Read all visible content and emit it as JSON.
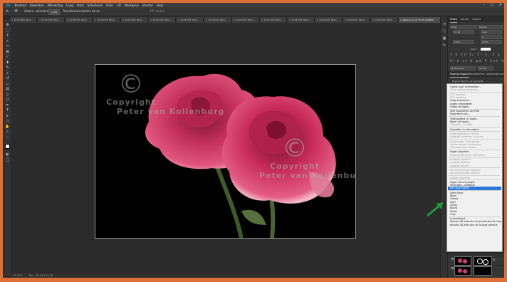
{
  "menubar": {
    "items": [
      "Bestand",
      "Bewerken",
      "Afbeelding",
      "Laag",
      "Tekst",
      "Selecteren",
      "Filter",
      "3D",
      "Weergave",
      "Venster",
      "Help"
    ],
    "controls": {
      "minimize": "–",
      "maximize": "□",
      "close": "✕"
    }
  },
  "options": {
    "home": "⌂",
    "tool": "✣",
    "auto_select": "Autom. selecteren:",
    "target": "Laag",
    "transform": "Transformeerkaders tonen",
    "mode3d": "3D-modus:"
  },
  "tabs": [
    "× 20181005 IMG0...",
    "× 20181005 IMG0...",
    "× 20181005 IMG0...",
    "× 20181005 IMG0...",
    "× 20181005 IMG0...",
    "× 20181005 IMG0...",
    "× 20181005 IMG0...",
    "× 20181005 IMG0...",
    "× 20181005 IMG0...",
    "× 20181005 IMG0...",
    "× 20181005 IMG0...",
    "× 20181005 IMG0...",
    "× 20181005 IMG0...",
    "× 20181005 IMG0...",
    "× Watermerk @ 33,3% (RGB/8)"
  ],
  "status": {
    "zoom": "33,33%",
    "doc": "Doc: 68,7M/133,5M"
  },
  "watermark": {
    "symbol": "©",
    "line1": "Copyright",
    "line2": "Peter van Kollenburg"
  },
  "properties_panel": {
    "tabs": [
      "Teken",
      "Alinea",
      "Glyphs"
    ],
    "font_family": "Arial",
    "font_style": "Regular",
    "size": "12 pt",
    "leading": "Auto",
    "tracking": "0",
    "scale_v": "100%",
    "scale_h": "100%",
    "color_label": "Kleur:",
    "language": "Nederlands",
    "aa": "Scherp"
  },
  "layers_panel": {
    "tabs": [
      "Eigenschappen",
      "Bibliotheken",
      "Laagaanpassingen"
    ],
    "filter": "Eigenschappen van gedeelte"
  },
  "context_menu": [
    {
      "label": "Opties voor overvloeien...",
      "dis": false
    },
    {
      "label": "Verspreiding bewerken...",
      "dis": true
    },
    {
      "sep": true
    },
    {
      "label": "CSS kopiëren",
      "dis": true
    },
    {
      "label": "SVG kopiëren",
      "dis": true
    },
    {
      "label": "Laag dupliceren...",
      "dis": false
    },
    {
      "label": "Lagen verwijderen",
      "dis": false
    },
    {
      "label": "Groep uit lagen...",
      "dis": false
    },
    {
      "sep": true
    },
    {
      "label": "Snel exporteren als PNG",
      "dis": false
    },
    {
      "label": "Exporteren als...",
      "dis": false
    },
    {
      "sep": true
    },
    {
      "label": "Tekengebied uit lagen...",
      "dis": false
    },
    {
      "label": "Kader uit lagen...",
      "dis": false
    },
    {
      "label": "Omzetten in kader",
      "dis": true
    },
    {
      "sep": true
    },
    {
      "label": "Omzetten in slim object",
      "dis": false
    },
    {
      "sep": true
    },
    {
      "label": "Laag omzetten in pixels",
      "dis": true
    },
    {
      "label": "Laagstijl omzetten in pixels",
      "dis": true
    },
    {
      "sep": true
    },
    {
      "label": "Laagmasker inschakelen",
      "dis": true
    },
    {
      "label": "Vectormasker inschakelen",
      "dis": true
    },
    {
      "label": "Uitknipmasker maken",
      "dis": true
    },
    {
      "sep": true
    },
    {
      "label": "Lagen koppelen",
      "dis": false
    },
    {
      "label": "Gekoppelde lagen selecteren",
      "dis": true
    },
    {
      "sep": true
    },
    {
      "label": "Laagstijl kopiëren",
      "dis": true
    },
    {
      "label": "Laagstijl plakken",
      "dis": true
    },
    {
      "label": "Laagstijl wissen",
      "dis": true
    },
    {
      "sep": true
    },
    {
      "label": "Vormkenmerken kopiëren",
      "dis": true
    },
    {
      "label": "Vormkenmerken plakken",
      "dis": true
    },
    {
      "sep": true
    },
    {
      "label": "Isolatie opheffen",
      "dis": true
    },
    {
      "sep": true
    },
    {
      "label": "Lagen samenvoegen",
      "dis": false
    },
    {
      "label": "Verenigen, zichtbaar",
      "dis": false
    },
    {
      "label": "Eén laag maken",
      "dis": false,
      "sel": true
    },
    {
      "sep": true
    },
    {
      "label": "Geen kleur",
      "dis": false
    },
    {
      "label": "Rood",
      "dis": false
    },
    {
      "label": "Oranje",
      "dis": false
    },
    {
      "label": "Geel",
      "dis": false
    },
    {
      "label": "Groen",
      "dis": false
    },
    {
      "label": "Blauw",
      "dis": false
    },
    {
      "label": "Violet",
      "dis": false
    },
    {
      "label": "Grijs",
      "dis": false
    },
    {
      "sep": true
    },
    {
      "label": "Ansichtkaart",
      "dis": false
    },
    {
      "label": "Nieuwe 3D-extrusie uit geselecteerde laag",
      "dis": false
    },
    {
      "label": "Nieuwe 3D-extrusie uit huidige selectie",
      "dis": false
    }
  ],
  "colors": {
    "highlight": "#2b7ad9",
    "arrow": "#1e9b3c",
    "rose": "#d63c6a"
  }
}
